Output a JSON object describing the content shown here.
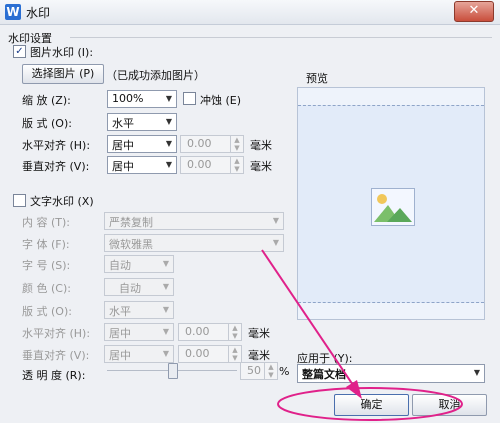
{
  "window": {
    "title": "水印",
    "app_icon_letter": "W",
    "close_label": "✕"
  },
  "section": {
    "title": "水印设置"
  },
  "picture_wm": {
    "checkbox_label": "图片水印 (I):",
    "checked": true,
    "select_button": "选择图片 (P)",
    "status": "（已成功添加图片）",
    "scale_label": "缩  放 (Z):",
    "scale_value": "100%",
    "washout_label": "冲蚀 (E)",
    "layout_label": "版  式 (O):",
    "layout_value": "水平",
    "h_align_label": "水平对齐 (H):",
    "h_align_value": "居中",
    "h_offset": "0.00",
    "h_unit": "毫米",
    "v_align_label": "垂直对齐 (V):",
    "v_align_value": "居中",
    "v_offset": "0.00",
    "v_unit": "毫米"
  },
  "text_wm": {
    "checkbox_label": "文字水印 (X)",
    "checked": false,
    "content_label": "内  容 (T):",
    "content_value": "严禁复制",
    "font_label": "字  体 (F):",
    "font_value": "微软雅黑",
    "size_label": "字  号 (S):",
    "size_value": "自动",
    "color_label": "颜  色 (C):",
    "color_value": "自动",
    "layout_label": "版  式 (O):",
    "layout_value": "水平",
    "h_align_label": "水平对齐 (H):",
    "h_align_value": "居中",
    "h_offset": "0.00",
    "h_unit": "毫米",
    "v_align_label": "垂直对齐 (V):",
    "v_align_value": "居中",
    "v_offset": "0.00",
    "v_unit": "毫米",
    "transparency_label": "透 明 度 (R):",
    "transparency_percent": 50,
    "transparency_value": "50",
    "transparency_unit": "%"
  },
  "preview": {
    "label": "预览"
  },
  "apply_to": {
    "label": "应用于 (Y):",
    "value": "整篇文档"
  },
  "buttons": {
    "ok": "确定",
    "cancel": "取消"
  },
  "colors": {
    "annotation": "#e0218a",
    "close": "#c94e3c",
    "accent": "#2b6fd3"
  }
}
